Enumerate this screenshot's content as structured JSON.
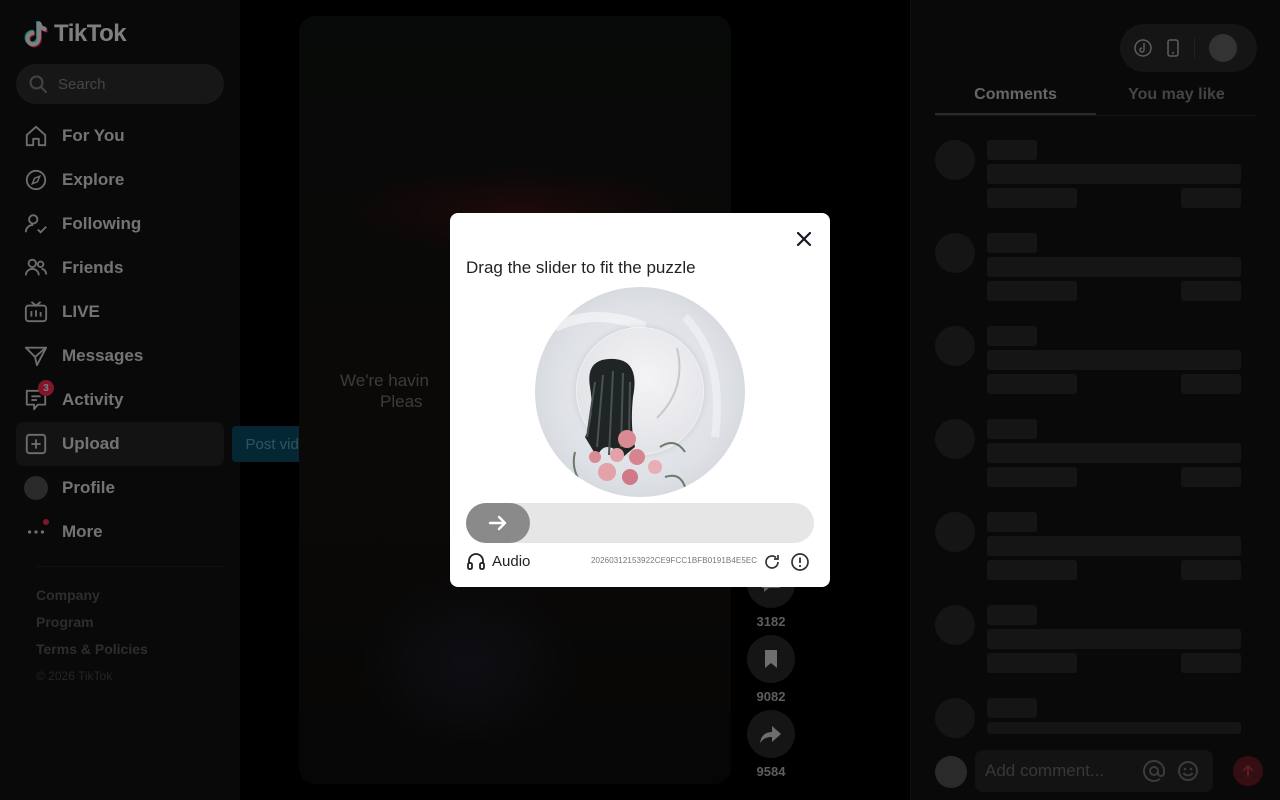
{
  "app": {
    "name": "TikTok"
  },
  "search": {
    "placeholder": "Search"
  },
  "nav": [
    {
      "label": "For You",
      "icon": "home-icon"
    },
    {
      "label": "Explore",
      "icon": "compass-icon"
    },
    {
      "label": "Following",
      "icon": "following-icon"
    },
    {
      "label": "Friends",
      "icon": "friends-icon"
    },
    {
      "label": "LIVE",
      "icon": "live-icon"
    },
    {
      "label": "Messages",
      "icon": "messages-icon"
    },
    {
      "label": "Activity",
      "icon": "activity-icon",
      "badge": "3"
    },
    {
      "label": "Upload",
      "icon": "upload-icon"
    },
    {
      "label": "Profile",
      "icon": "avatar"
    },
    {
      "label": "More",
      "icon": "more-icon"
    }
  ],
  "upload_tooltip": "Post video",
  "footer": {
    "links": [
      "Company",
      "Program",
      "Terms & Policies"
    ],
    "copyright": "© 2026 TikTok"
  },
  "video": {
    "error_line1": "We're havin",
    "error_line2": "Pleas"
  },
  "actions": [
    {
      "name": "share-count-a",
      "count": "3182",
      "icon": "comment-icon"
    },
    {
      "name": "favorite",
      "count": "9082",
      "icon": "bookmark-icon"
    },
    {
      "name": "share",
      "count": "9584",
      "icon": "share-icon"
    }
  ],
  "right_panel": {
    "tabs": [
      "Comments",
      "You may like"
    ],
    "active_tab": "Comments",
    "comment_placeholder": "Add comment..."
  },
  "captcha": {
    "title": "Drag the slider to fit the puzzle",
    "audio_label": "Audio",
    "code": "20260312153922CE9FCC1BFB0191B4E5EC",
    "slider_progress": 0
  },
  "colors": {
    "accent": "#fe2c55",
    "tooltip_bg": "#0a4f67"
  }
}
